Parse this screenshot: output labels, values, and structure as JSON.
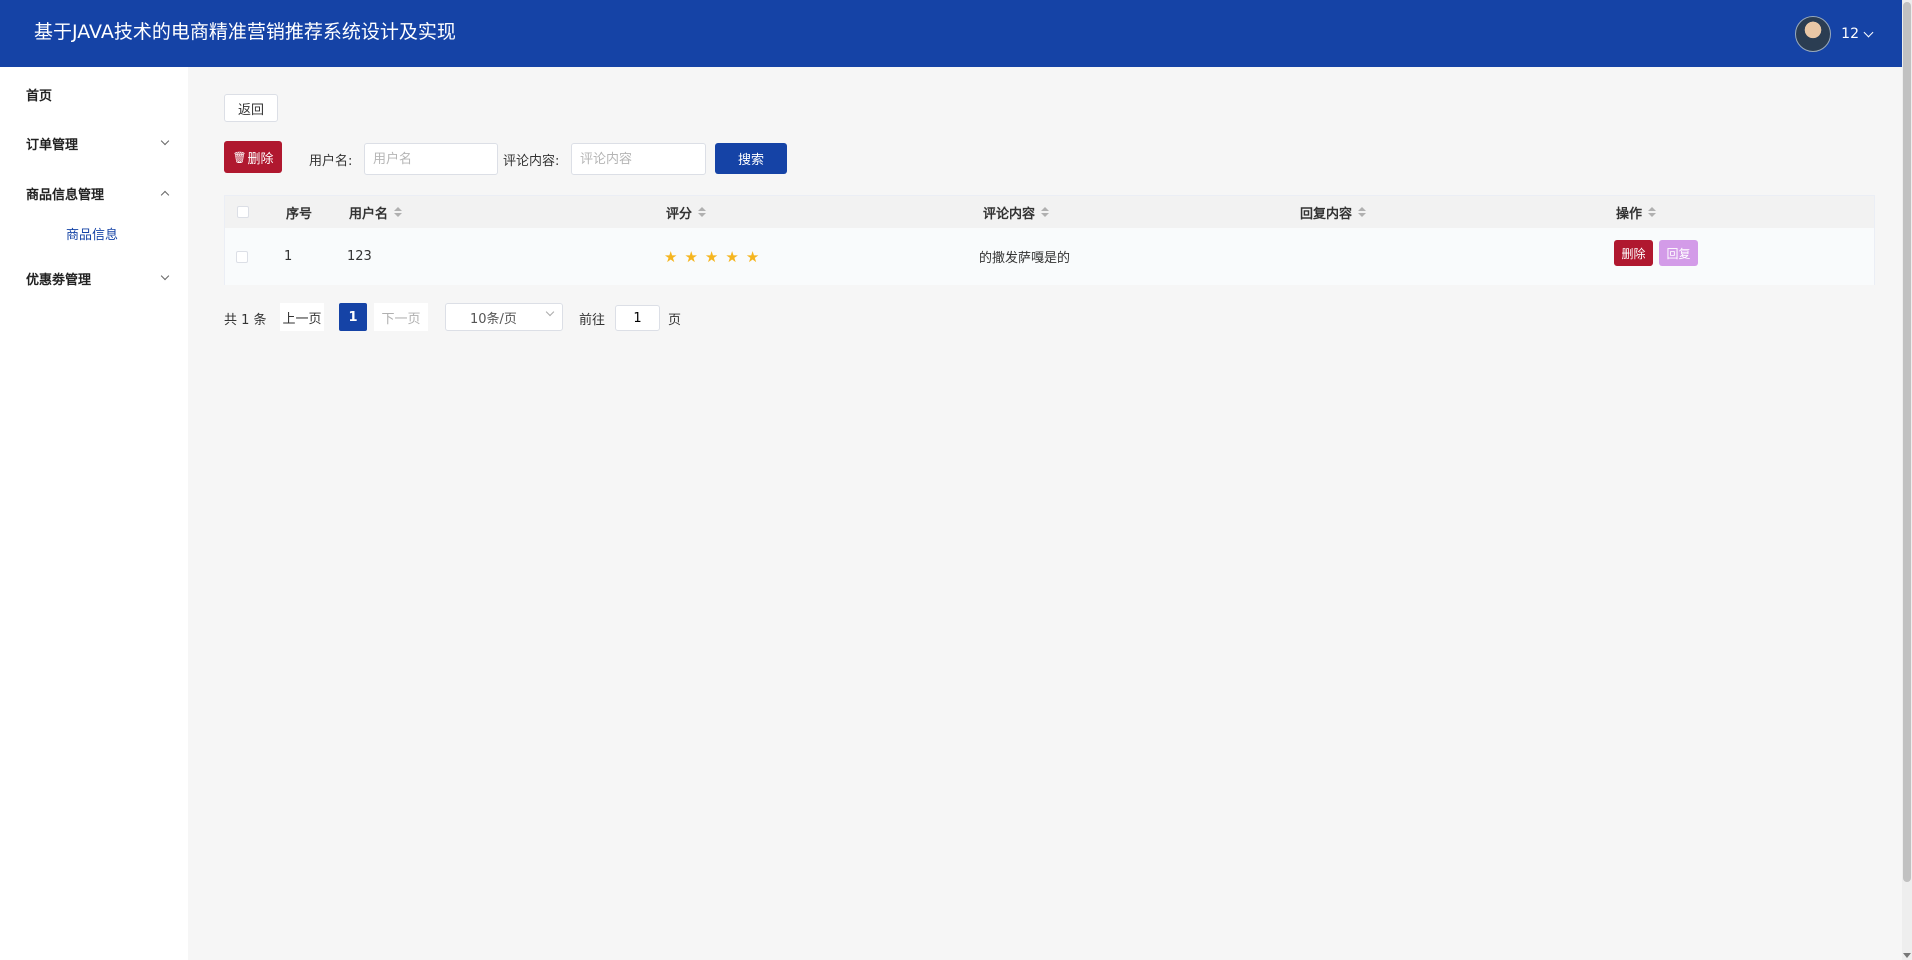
{
  "header": {
    "title": "基于JAVA技术的电商精准营销推荐系统设计及实现",
    "username": "12"
  },
  "sidebar": {
    "items": [
      {
        "label": "首页"
      },
      {
        "label": "订单管理"
      },
      {
        "label": "商品信息管理"
      },
      {
        "label": "优惠劵管理"
      }
    ],
    "submenu": {
      "label": "商品信息"
    }
  },
  "toolbar": {
    "back_label": "返回",
    "delete_label": "删除",
    "username_label": "用户名:",
    "username_placeholder": "用户名",
    "comment_label": "评论内容:",
    "comment_placeholder": "评论内容",
    "search_label": "搜索"
  },
  "table": {
    "headers": [
      "序号",
      "用户名",
      "评分",
      "评论内容",
      "回复内容",
      "操作"
    ],
    "rows": [
      {
        "index": "1",
        "username": "123",
        "rating": 5,
        "comment": "的撒发萨嘎是的",
        "reply": "",
        "delete_label": "删除",
        "reply_label": "回复"
      }
    ]
  },
  "pagination": {
    "total_label": "共 1 条",
    "prev_label": "上一页",
    "current_page": "1",
    "next_label": "下一页",
    "page_size_label": "10条/页",
    "goto_label": "前往",
    "goto_value": "1",
    "page_suffix": "页"
  },
  "colors": {
    "primary": "#1543a6",
    "danger": "#b0182f",
    "reply": "#d39be8",
    "star": "#f5b51f"
  }
}
